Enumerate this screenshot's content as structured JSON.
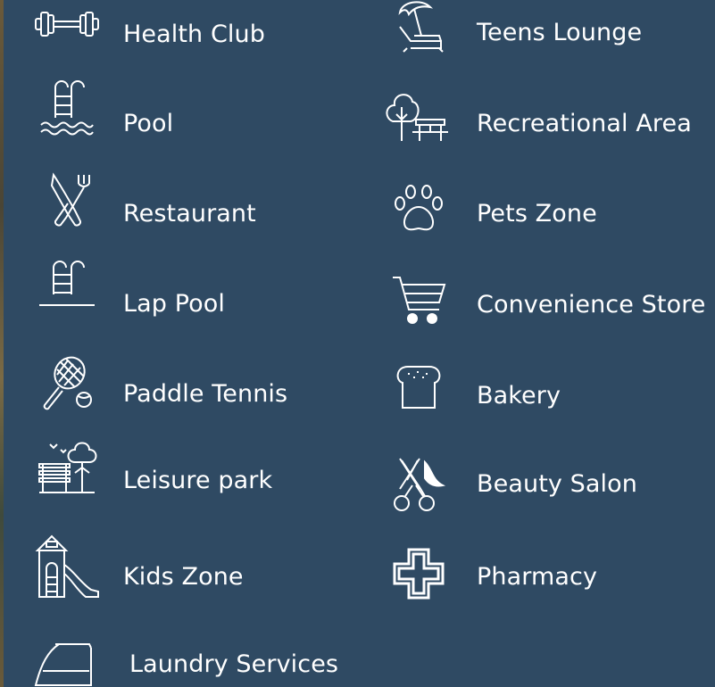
{
  "amenities": {
    "left": [
      {
        "label": "Health Club",
        "icon": "dumbbell-icon"
      },
      {
        "label": "Pool",
        "icon": "pool-ladder-waves-icon"
      },
      {
        "label": "Restaurant",
        "icon": "knife-fork-icon"
      },
      {
        "label": "Lap Pool",
        "icon": "pool-ladder-icon"
      },
      {
        "label": "Paddle Tennis",
        "icon": "tennis-racket-ball-icon"
      },
      {
        "label": "Leisure park",
        "icon": "park-bench-tree-icon"
      },
      {
        "label": "Kids Zone",
        "icon": "playhouse-slide-icon"
      },
      {
        "label": "Laundry Services",
        "icon": "iron-icon"
      }
    ],
    "right": [
      {
        "label": "Teens Lounge",
        "icon": "beach-umbrella-chair-icon"
      },
      {
        "label": "Recreational Area",
        "icon": "tree-picnic-table-icon"
      },
      {
        "label": "Pets Zone",
        "icon": "paw-print-icon"
      },
      {
        "label": "Convenience Store",
        "icon": "shopping-cart-icon"
      },
      {
        "label": "Bakery",
        "icon": "bread-loaf-icon"
      },
      {
        "label": "Beauty Salon",
        "icon": "scissors-comb-icon"
      },
      {
        "label": "Pharmacy",
        "icon": "medical-cross-icon"
      }
    ]
  },
  "colors": {
    "background": "#2f4a63",
    "foreground": "#ffffff"
  }
}
